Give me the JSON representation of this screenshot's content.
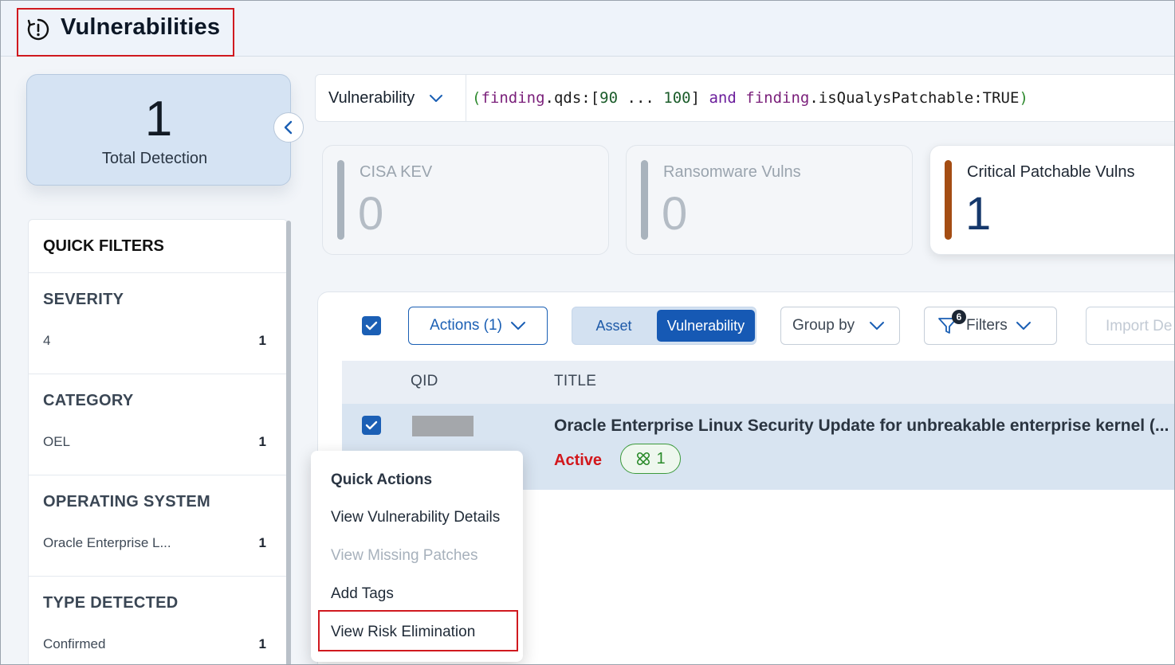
{
  "header": {
    "title": "Vulnerabilities",
    "icon": "alert-history-icon"
  },
  "summary": {
    "total_value": "1",
    "total_label": "Total Detection"
  },
  "quick_filters": {
    "title": "QUICK FILTERS",
    "sections": [
      {
        "heading": "SEVERITY",
        "item": "4",
        "count": "1"
      },
      {
        "heading": "CATEGORY",
        "item": "OEL",
        "count": "1"
      },
      {
        "heading": "OPERATING SYSTEM",
        "item": "Oracle Enterprise L...",
        "count": "1"
      },
      {
        "heading": "TYPE DETECTED",
        "item": "Confirmed",
        "count": "1"
      }
    ]
  },
  "query": {
    "type": "Vulnerability",
    "tokens": {
      "open": "(",
      "field1": "finding",
      "dot1": ".qds:[",
      "num1": "90",
      "range": " ... ",
      "num2": "100",
      "close1": "] ",
      "and": "and",
      "space": " ",
      "field2": "finding",
      "rest": ".isQualysPatchable:TRUE",
      "close": ")"
    }
  },
  "stats": [
    {
      "label": "CISA KEV",
      "value": "0",
      "bar_color": "#a9b3bd"
    },
    {
      "label": "Ransomware Vulns",
      "value": "0",
      "bar_color": "#a9b3bd"
    },
    {
      "label": "Critical Patchable Vulns",
      "value": "1",
      "bar_color": "#a44d13"
    }
  ],
  "toolbar": {
    "actions_label": "Actions (1)",
    "asset_label": "Asset",
    "vulnerability_label": "Vulnerability",
    "group_by_label": "Group by",
    "filters_label": "Filters",
    "filters_badge": "6",
    "import_label": "Import De"
  },
  "table": {
    "columns": [
      "QID",
      "TITLE"
    ],
    "rows": [
      {
        "title": "Oracle Enterprise Linux Security Update for unbreakable enterprise kernel (...",
        "status": "Active",
        "pill_count": "1"
      }
    ]
  },
  "quick_actions": {
    "heading": "Quick Actions",
    "items": [
      {
        "label": "View Vulnerability Details",
        "enabled": true
      },
      {
        "label": "View Missing Patches",
        "enabled": false
      },
      {
        "label": "Add Tags",
        "enabled": true
      },
      {
        "label": "View Risk Elimination",
        "enabled": true
      }
    ]
  },
  "colors": {
    "primary": "#1659b4",
    "highlight_red": "#d0191f",
    "status_active": "#d2171c",
    "pill_green": "#2a8a2a"
  }
}
